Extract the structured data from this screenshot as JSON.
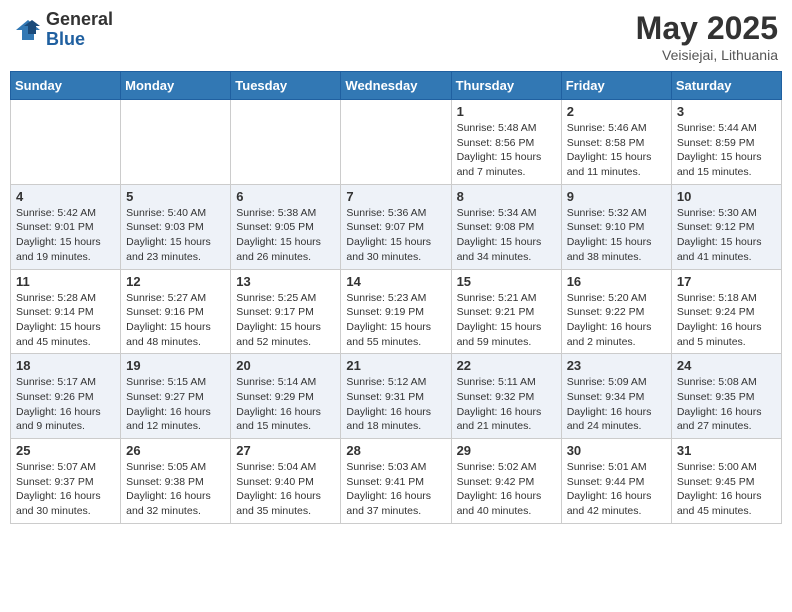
{
  "header": {
    "logo_general": "General",
    "logo_blue": "Blue",
    "title": "May 2025",
    "subtitle": "Veisiejai, Lithuania"
  },
  "days_of_week": [
    "Sunday",
    "Monday",
    "Tuesday",
    "Wednesday",
    "Thursday",
    "Friday",
    "Saturday"
  ],
  "weeks": [
    [
      {
        "day": "",
        "info": ""
      },
      {
        "day": "",
        "info": ""
      },
      {
        "day": "",
        "info": ""
      },
      {
        "day": "",
        "info": ""
      },
      {
        "day": "1",
        "info": "Sunrise: 5:48 AM\nSunset: 8:56 PM\nDaylight: 15 hours\nand 7 minutes."
      },
      {
        "day": "2",
        "info": "Sunrise: 5:46 AM\nSunset: 8:58 PM\nDaylight: 15 hours\nand 11 minutes."
      },
      {
        "day": "3",
        "info": "Sunrise: 5:44 AM\nSunset: 8:59 PM\nDaylight: 15 hours\nand 15 minutes."
      }
    ],
    [
      {
        "day": "4",
        "info": "Sunrise: 5:42 AM\nSunset: 9:01 PM\nDaylight: 15 hours\nand 19 minutes."
      },
      {
        "day": "5",
        "info": "Sunrise: 5:40 AM\nSunset: 9:03 PM\nDaylight: 15 hours\nand 23 minutes."
      },
      {
        "day": "6",
        "info": "Sunrise: 5:38 AM\nSunset: 9:05 PM\nDaylight: 15 hours\nand 26 minutes."
      },
      {
        "day": "7",
        "info": "Sunrise: 5:36 AM\nSunset: 9:07 PM\nDaylight: 15 hours\nand 30 minutes."
      },
      {
        "day": "8",
        "info": "Sunrise: 5:34 AM\nSunset: 9:08 PM\nDaylight: 15 hours\nand 34 minutes."
      },
      {
        "day": "9",
        "info": "Sunrise: 5:32 AM\nSunset: 9:10 PM\nDaylight: 15 hours\nand 38 minutes."
      },
      {
        "day": "10",
        "info": "Sunrise: 5:30 AM\nSunset: 9:12 PM\nDaylight: 15 hours\nand 41 minutes."
      }
    ],
    [
      {
        "day": "11",
        "info": "Sunrise: 5:28 AM\nSunset: 9:14 PM\nDaylight: 15 hours\nand 45 minutes."
      },
      {
        "day": "12",
        "info": "Sunrise: 5:27 AM\nSunset: 9:16 PM\nDaylight: 15 hours\nand 48 minutes."
      },
      {
        "day": "13",
        "info": "Sunrise: 5:25 AM\nSunset: 9:17 PM\nDaylight: 15 hours\nand 52 minutes."
      },
      {
        "day": "14",
        "info": "Sunrise: 5:23 AM\nSunset: 9:19 PM\nDaylight: 15 hours\nand 55 minutes."
      },
      {
        "day": "15",
        "info": "Sunrise: 5:21 AM\nSunset: 9:21 PM\nDaylight: 15 hours\nand 59 minutes."
      },
      {
        "day": "16",
        "info": "Sunrise: 5:20 AM\nSunset: 9:22 PM\nDaylight: 16 hours\nand 2 minutes."
      },
      {
        "day": "17",
        "info": "Sunrise: 5:18 AM\nSunset: 9:24 PM\nDaylight: 16 hours\nand 5 minutes."
      }
    ],
    [
      {
        "day": "18",
        "info": "Sunrise: 5:17 AM\nSunset: 9:26 PM\nDaylight: 16 hours\nand 9 minutes."
      },
      {
        "day": "19",
        "info": "Sunrise: 5:15 AM\nSunset: 9:27 PM\nDaylight: 16 hours\nand 12 minutes."
      },
      {
        "day": "20",
        "info": "Sunrise: 5:14 AM\nSunset: 9:29 PM\nDaylight: 16 hours\nand 15 minutes."
      },
      {
        "day": "21",
        "info": "Sunrise: 5:12 AM\nSunset: 9:31 PM\nDaylight: 16 hours\nand 18 minutes."
      },
      {
        "day": "22",
        "info": "Sunrise: 5:11 AM\nSunset: 9:32 PM\nDaylight: 16 hours\nand 21 minutes."
      },
      {
        "day": "23",
        "info": "Sunrise: 5:09 AM\nSunset: 9:34 PM\nDaylight: 16 hours\nand 24 minutes."
      },
      {
        "day": "24",
        "info": "Sunrise: 5:08 AM\nSunset: 9:35 PM\nDaylight: 16 hours\nand 27 minutes."
      }
    ],
    [
      {
        "day": "25",
        "info": "Sunrise: 5:07 AM\nSunset: 9:37 PM\nDaylight: 16 hours\nand 30 minutes."
      },
      {
        "day": "26",
        "info": "Sunrise: 5:05 AM\nSunset: 9:38 PM\nDaylight: 16 hours\nand 32 minutes."
      },
      {
        "day": "27",
        "info": "Sunrise: 5:04 AM\nSunset: 9:40 PM\nDaylight: 16 hours\nand 35 minutes."
      },
      {
        "day": "28",
        "info": "Sunrise: 5:03 AM\nSunset: 9:41 PM\nDaylight: 16 hours\nand 37 minutes."
      },
      {
        "day": "29",
        "info": "Sunrise: 5:02 AM\nSunset: 9:42 PM\nDaylight: 16 hours\nand 40 minutes."
      },
      {
        "day": "30",
        "info": "Sunrise: 5:01 AM\nSunset: 9:44 PM\nDaylight: 16 hours\nand 42 minutes."
      },
      {
        "day": "31",
        "info": "Sunrise: 5:00 AM\nSunset: 9:45 PM\nDaylight: 16 hours\nand 45 minutes."
      }
    ]
  ]
}
